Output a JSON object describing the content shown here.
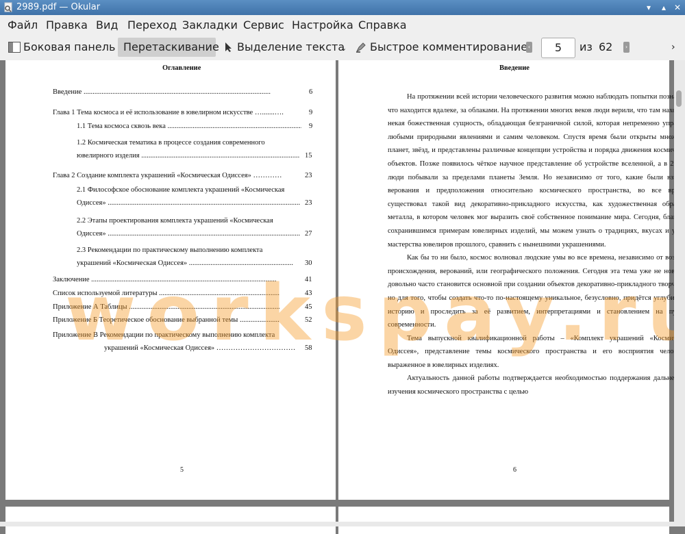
{
  "window": {
    "title": "2989.pdf  — Okular"
  },
  "menu": [
    "Файл",
    "Правка",
    "Вид",
    "Переход",
    "Закладки",
    "Сервис",
    "Настройка",
    "Справка"
  ],
  "toolbar": {
    "sidebar": "Боковая панель",
    "drag": "Перетаскивание",
    "text_select": "Выделение текста",
    "comment": "Быстрое комментирование",
    "page_current": "5",
    "page_of": "из",
    "page_total": "62"
  },
  "watermark": "workspay.ru",
  "left_page": {
    "heading": "Оглавление",
    "number": "5",
    "toc": [
      {
        "text": "Введение ........................................................................................................",
        "page": "6"
      },
      {
        "text": "Глава 1 Тема космоса и её использование в ювелирном искусстве ….......….",
        "page": "9"
      },
      {
        "text": "1.1 Тема космоса сквозь века .............................................................................",
        "page": "9"
      },
      {
        "text": "1.2 Космическая тематика в процессе создания современного",
        "page": ""
      },
      {
        "text": "ювелирного изделия ..........................................................................................",
        "page": "15"
      },
      {
        "text": "Глава 2 Создание комплекта украшений «Космическая Одиссея» …………",
        "page": "23"
      },
      {
        "text": "2.1 Философское обоснование комплекта украшений «Космическая",
        "page": ""
      },
      {
        "text": "Одиссея» .................................................................................................................",
        "page": "23"
      },
      {
        "text": "2.2 Этапы проектирования комплекта украшений «Космическая",
        "page": ""
      },
      {
        "text": "Одиссея» .................................................................................................................",
        "page": "27"
      },
      {
        "text": "2.3 Рекомендации по практическому выполнению комплекта",
        "page": ""
      },
      {
        "text": "украшений «Космическая Одиссея» ..........................................................",
        "page": "30"
      },
      {
        "text": "Заключение .......................................................................................................",
        "page": "41"
      },
      {
        "text": "Список используемой литературы ...................................................................",
        "page": "43"
      },
      {
        "text": "Приложение А Таблицы ....................................................................................",
        "page": "45"
      },
      {
        "text": "Приложение Б Теоретическое обоснование выбранной темы ......................",
        "page": "52"
      },
      {
        "text": "Приложение В Рекомендации по практическому выполнению комплекта",
        "page": ""
      },
      {
        "text": "украшений «Космическая Одиссея» ……………………………",
        "page": "58"
      }
    ]
  },
  "right_page": {
    "heading": "Введение",
    "number": "6",
    "paragraphs": [
      "На протяжении всей истории человеческого развития можно наблюдать попытки познать то, что находится вдалеке, за облаками. На протяжении многих веков люди верили, что там находится некая божественная сущность, обладающая безграничной силой, которая непременно управляет любыми природными явлениями и самим человеком. Спустя время были открыты множество планет, звёзд, и представлены различные концепции устройства и порядка движения космических объектов. Позже появилось чёткое научное представление об устройстве вселенной, а в 20 веке люди побывали за пределами планеты Земля. Но независимо от того, какие были взгляды, верования и предположения относительно космического пространства, во все времена существовал такой вид декоративно-прикладного искусства, как художественная обработка металла, в котором человек мог выразить своё собственное понимание мира. Сегодня, благодаря сохранившимся примерам ювелирных изделий, мы можем узнать о традициях, вкусах и уровне мастерства ювелиров прошлого, сравнить с нынешними украшениями.",
      "Как бы то ни было, космос волновал людские умы во все времена, независимо от возраста, происхождения, верований, или географического положения. Сегодня эта тема уже не нова, она довольно часто становится основной при создании объектов декоративно-прикладного творчества, но для того, чтобы создать что-то по-настоящему уникальное, безусловно, придётся углубиться в историю и проследить за её развитием, интерпретациями и становлением на пути к современности.",
      "Тема выпускной квалификационной работы – «Комплект украшений «Космическая Одиссея», представление темы космического пространства и его восприятия человеком, выраженное в ювелирных изделиях.",
      "Актуальность данной работы подтверждается необходимостью поддержания дальнейшего изучения космического пространства с целью"
    ]
  }
}
